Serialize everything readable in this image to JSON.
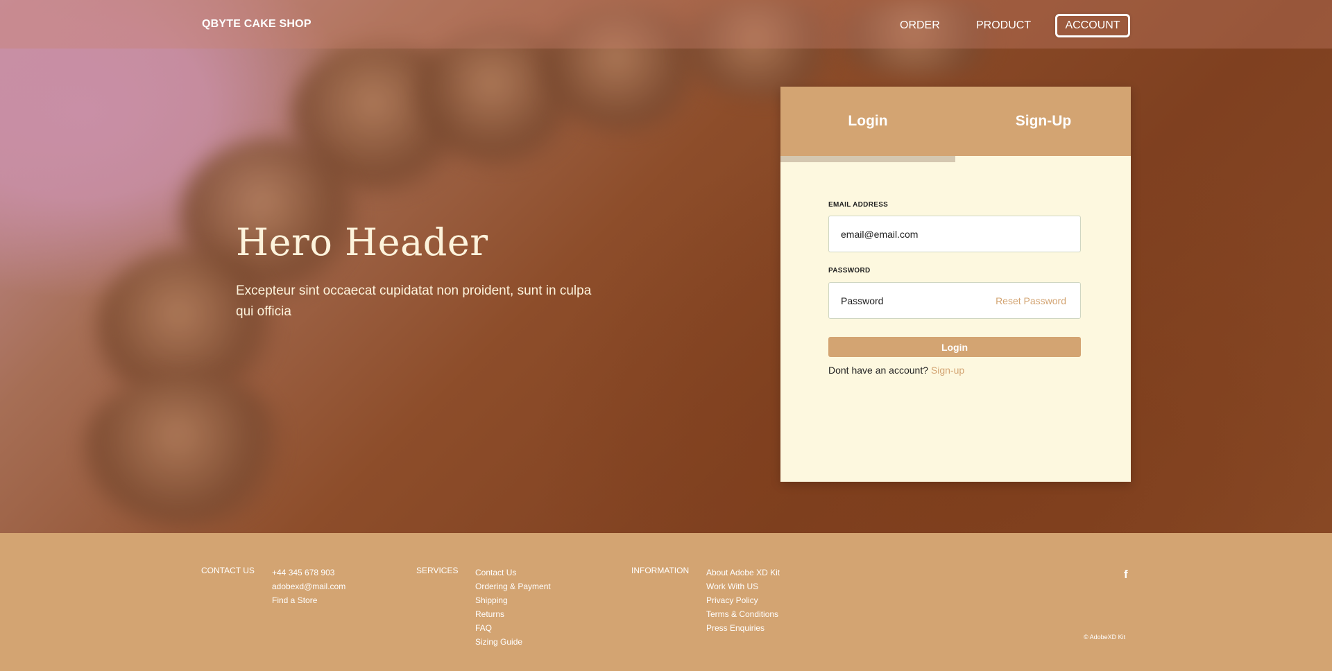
{
  "navbar": {
    "brand": "QBYTE CAKE SHOP",
    "links": [
      "ORDER",
      "PRODUCT",
      "ACCOUNT"
    ]
  },
  "hero": {
    "title": "Hero Header",
    "subtitle": "Excepteur sint occaecat cupidatat non proident, sunt in culpa qui officia"
  },
  "auth_card": {
    "tabs": [
      {
        "label": "Login",
        "active": true
      },
      {
        "label": "Sign-Up",
        "active": false
      }
    ],
    "email_label": "EMAIL ADDRESS",
    "email_value": "email@email.com",
    "password_label": "PASSWORD",
    "password_placeholder": "Password",
    "reset_label": "Reset Password",
    "login_button": "Login",
    "no_account_text": "Dont have an account? ",
    "signup_link": "Sign-up"
  },
  "footer": {
    "contact": {
      "heading": "CONTACT US",
      "items": [
        "+44 345 678 903",
        "adobexd@mail.com",
        "Find a Store"
      ]
    },
    "services": {
      "heading": "SERVICES",
      "items": [
        "Contact Us",
        "Ordering & Payment",
        "Shipping",
        "Returns",
        "FAQ",
        "Sizing Guide"
      ]
    },
    "information": {
      "heading": "INFORMATION",
      "items": [
        "About Adobe XD Kit",
        "Work With US",
        "Privacy Policy",
        "Terms & Conditions",
        "Press Enquiries"
      ]
    },
    "social_icon": "facebook-icon",
    "social_glyph": "f",
    "copyright": "© AdobeXD Kit"
  },
  "colors": {
    "accent": "#d3a472",
    "card_bg": "#fdf8df",
    "hero_text": "#fdf3dc"
  }
}
